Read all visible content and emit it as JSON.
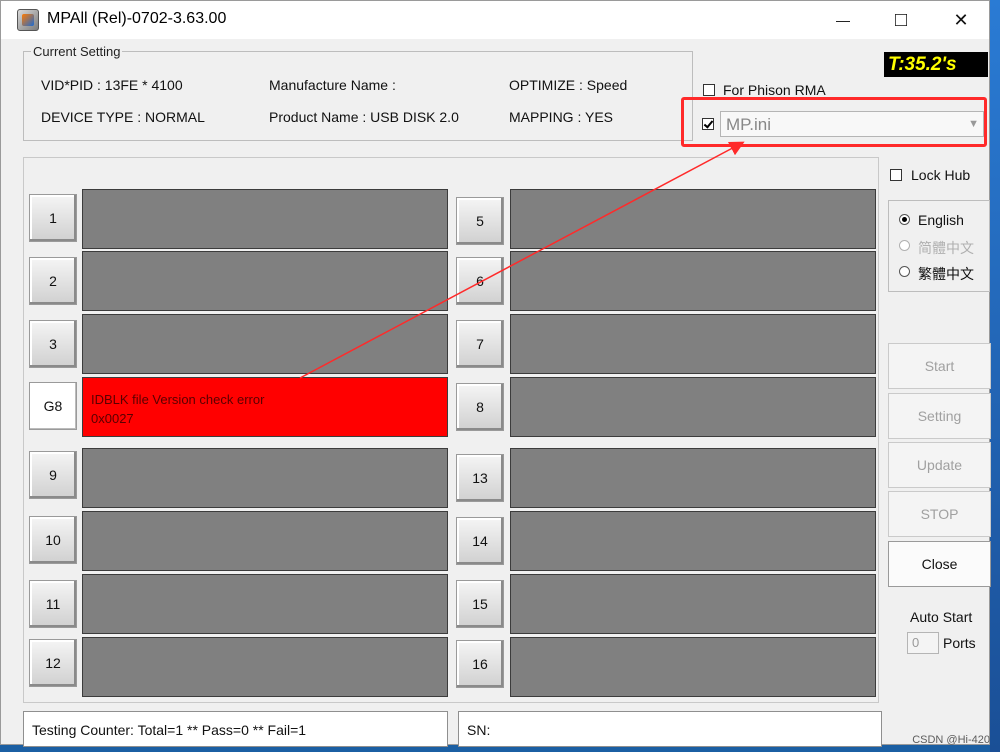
{
  "window": {
    "title": "MPAll (Rel)-0702-3.63.00",
    "minimize_glyph": "—",
    "maximize_glyph": "□",
    "close_glyph": "✕"
  },
  "current_setting": {
    "title": "Current Setting",
    "vid_pid": "VID*PID : 13FE * 4100",
    "device_type": "DEVICE TYPE : NORMAL",
    "manufacture_name": "Manufacture Name :",
    "product_name": "Product Name : USB DISK 2.0",
    "optimize": "OPTIMIZE : Speed",
    "mapping": "MAPPING : YES"
  },
  "timer": "T:35.2's",
  "phison_rma": {
    "label": "For Phison RMA",
    "checked": false
  },
  "ini": {
    "checked": true,
    "value": "MP.ini",
    "arrow_glyph": "▼"
  },
  "lock_hub": {
    "label": "Lock Hub",
    "checked": false
  },
  "languages": [
    {
      "label": "English",
      "checked": true,
      "disabled": false
    },
    {
      "label": "简體中文",
      "checked": false,
      "disabled": true
    },
    {
      "label": "繁體中文",
      "checked": false,
      "disabled": false
    }
  ],
  "buttons": {
    "start": "Start",
    "setting": "Setting",
    "update": "Update",
    "stop": "STOP",
    "close": "Close"
  },
  "auto_start": {
    "label": "Auto Start",
    "ports_value": "0",
    "ports_label": "Ports"
  },
  "ports_left": [
    {
      "label": "1",
      "status": ""
    },
    {
      "label": "2",
      "status": ""
    },
    {
      "label": "3",
      "status": ""
    },
    {
      "label": "G8",
      "status": "IDBLK file Version check error",
      "code": "0x0027",
      "error": true
    },
    {
      "label": "9",
      "status": ""
    },
    {
      "label": "10",
      "status": ""
    },
    {
      "label": "11",
      "status": ""
    },
    {
      "label": "12",
      "status": ""
    }
  ],
  "ports_right": [
    {
      "label": "5"
    },
    {
      "label": "6"
    },
    {
      "label": "7"
    },
    {
      "label": "8"
    },
    {
      "label": "13"
    },
    {
      "label": "14"
    },
    {
      "label": "15"
    },
    {
      "label": "16"
    }
  ],
  "status_bar": {
    "counter": "Testing Counter: Total=1 ** Pass=0 ** Fail=1",
    "sn": "SN:"
  },
  "watermark": "CSDN @Hi-420",
  "colors": {
    "error_red": "#ff0000",
    "annotation_red": "#ff2a2a",
    "timer_yellow": "#ffff00",
    "port_gray": "#808080"
  }
}
